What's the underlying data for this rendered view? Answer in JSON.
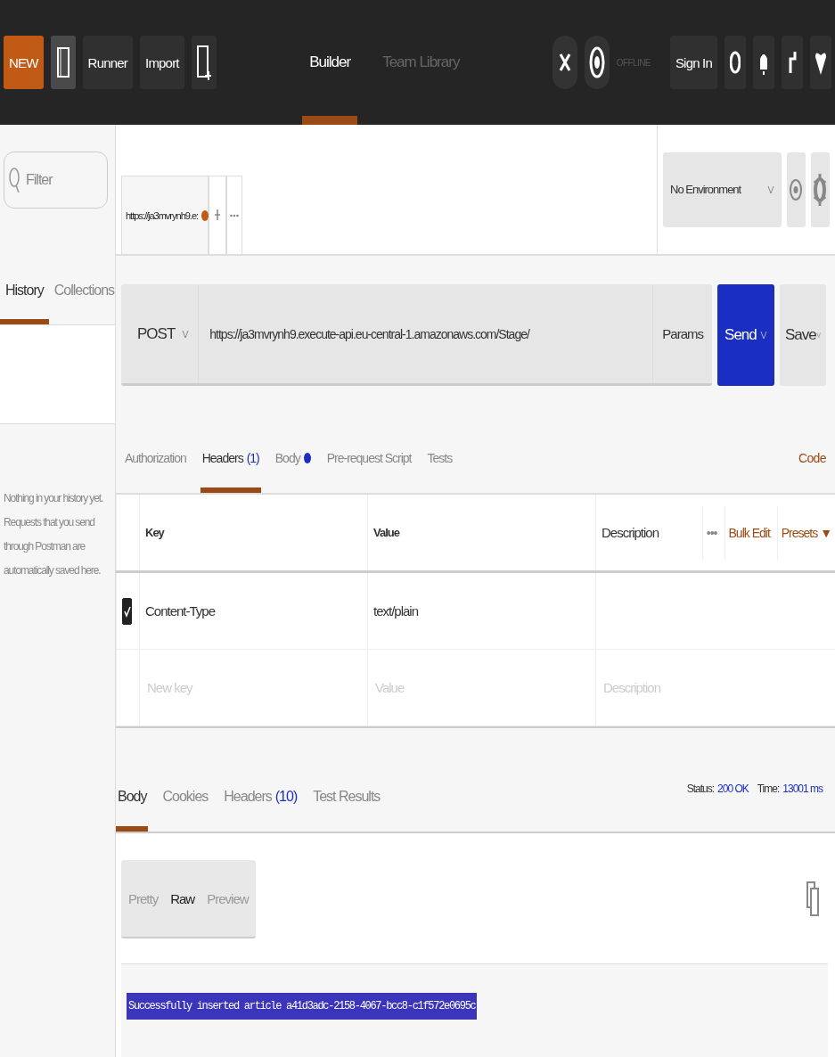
{
  "toolbar": {
    "new_button": "NEW",
    "buttons": [
      {
        "kind": "icon"
      },
      {
        "kind": "text",
        "label": "Runner"
      },
      {
        "kind": "text",
        "label": "Import"
      },
      {
        "kind": "newwindow"
      }
    ],
    "views": [
      {
        "label": "Builder",
        "selected": true
      },
      {
        "label": "Team Library",
        "selected": false
      }
    ],
    "status": "OFFLINE",
    "sign_in": "Sign In"
  },
  "sidebar": {
    "filter": {
      "placeholder": "Filter"
    },
    "tabs": [
      {
        "label": "History",
        "selected": true
      },
      {
        "label": "Collections",
        "selected": false
      }
    ],
    "empty_text": "Nothing in your history yet. Requests that you send through Postman are automatically saved here."
  },
  "request_tabs": [
    {
      "label": "https://ja3mvrynh9.e:",
      "selected": true,
      "unsaved": true
    }
  ],
  "environment": {
    "value": "No Environment"
  },
  "request": {
    "method": "POST",
    "url": "https://ja3mvrynh9.execute-api.eu-central-1.amazonaws.com/Stage/",
    "params": "Params",
    "send": "Send",
    "save": "Save"
  },
  "request_sections": [
    {
      "label": "Authorization",
      "selected": false
    },
    {
      "label": "Headers",
      "count": "(1)",
      "selected": true
    },
    {
      "label": "Body",
      "selected": false,
      "dot": true
    },
    {
      "label": "Pre-request Script",
      "selected": false
    },
    {
      "label": "Tests",
      "selected": false
    }
  ],
  "code_link": "Code",
  "headers_table": {
    "columns": [
      "Key",
      "Value",
      "Description"
    ],
    "actions": {
      "more": "•••",
      "bulk_edit": "Bulk Edit",
      "presets": "Presets ▼"
    },
    "rows": [
      {
        "key": "Content-Type",
        "value": "text/plain",
        "checked": true
      }
    ],
    "new_row": {
      "key_placeholder": "New key",
      "value_placeholder": "Value",
      "description_placeholder": "Description"
    }
  },
  "response_tabs": [
    {
      "label": "Body",
      "selected": true
    },
    {
      "label": "Cookies",
      "selected": false
    },
    {
      "label": "Headers",
      "count": "(10)",
      "selected": false
    },
    {
      "label": "Test Results",
      "selected": false
    }
  ],
  "response_status": {
    "status_label": "Status:",
    "status": "200 OK",
    "time_label": "Time:",
    "time": "13001 ms"
  },
  "view_modes": [
    {
      "label": "Pretty",
      "selected": false
    },
    {
      "label": "Raw",
      "selected": true
    },
    {
      "label": "Preview",
      "selected": false
    }
  ],
  "response_body": "Successfully inserted article a41d3adc-2158-4067-bcc8-c1f572e0695c"
}
